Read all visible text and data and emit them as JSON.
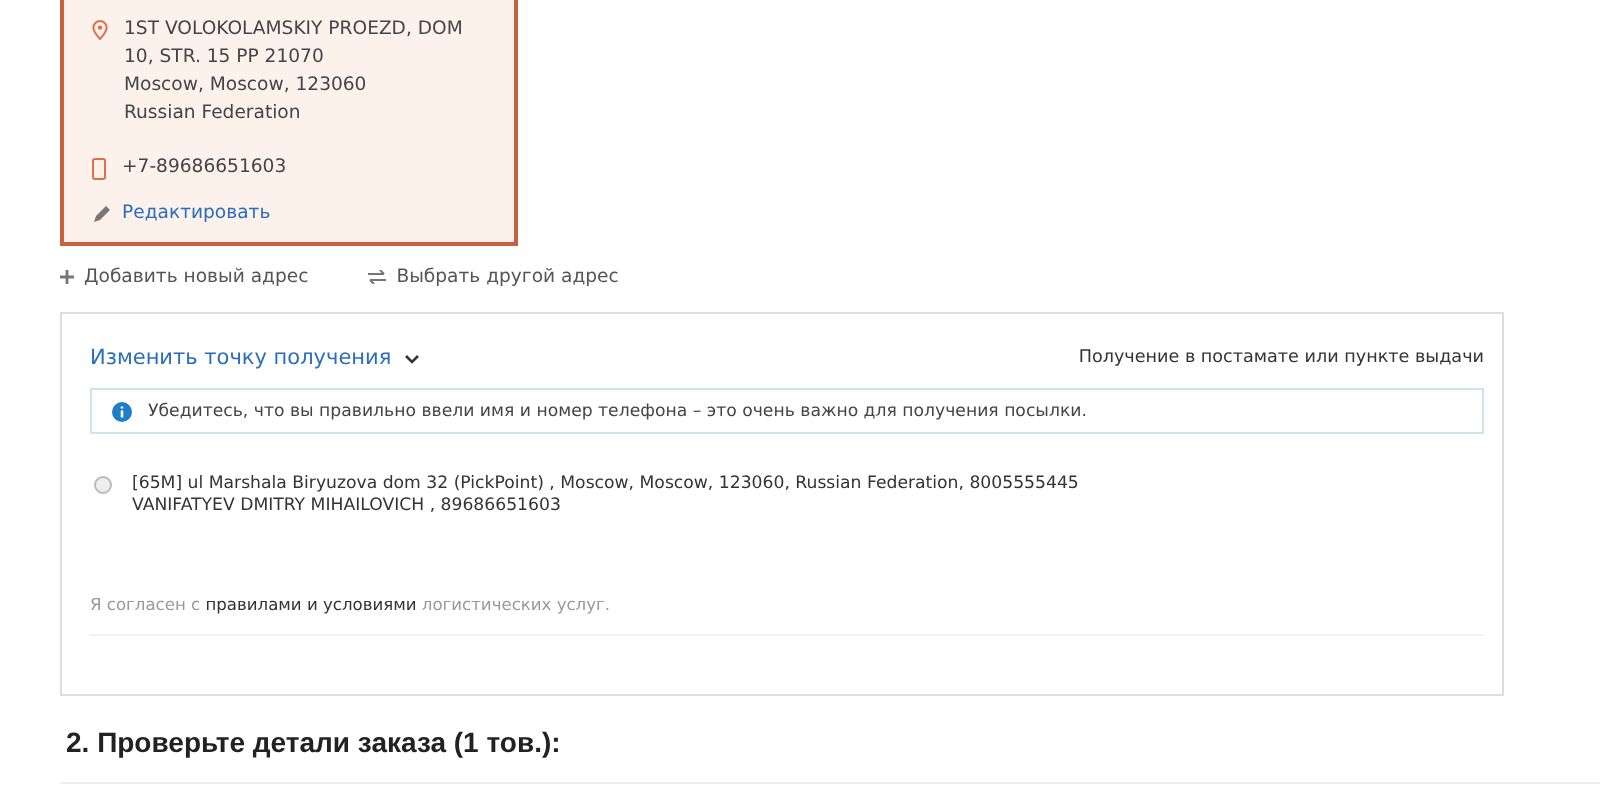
{
  "address_card": {
    "selected": true,
    "address_lines": [
      "1ST VOLOKOLAMSKIY PROEZD, DOM 10, STR. 15 PP 21070",
      "Moscow, Moscow, 123060",
      "Russian Federation"
    ],
    "phone": "+7-89686651603",
    "edit_link": "Редактировать"
  },
  "address_actions": [
    {
      "kind": "add",
      "label": "Добавить новый адрес"
    },
    {
      "kind": "choose",
      "label": "Выбрать другой адрес"
    }
  ],
  "pickup": {
    "change_link": "Изменить точку получения",
    "delivery_type": "Получение в постамате или пункте выдачи",
    "notice": "Убедитесь, что вы правильно ввели имя и номер телефона – это очень важно для получения посылки.",
    "options": [
      {
        "selected": false,
        "lines": [
          "[65M] ul Marshala Biryuzova dom 32 (PickPoint) , Moscow, Moscow, 123060, Russian Federation, 8005555445",
          "VANIFATYEV DMITRY MIHAILOVICH , 89686651603"
        ]
      }
    ],
    "terms": "Я согласен с **правилами и условиями** логистических услуг."
  },
  "section_heading": "2. Проверьте детали заказа (1 тов.):"
}
